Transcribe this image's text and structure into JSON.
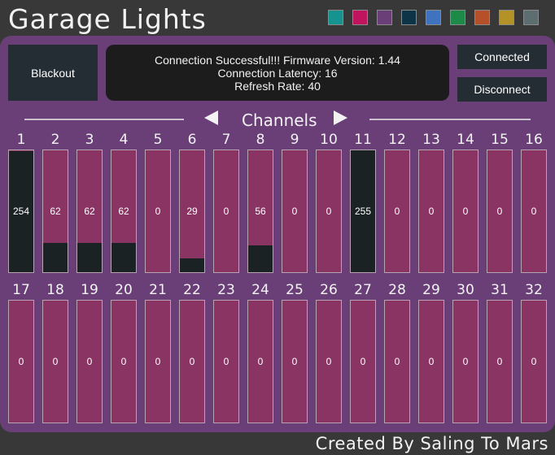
{
  "app": {
    "title": "Garage Lights"
  },
  "swatches": [
    {
      "name": "teal",
      "color": "#16938e"
    },
    {
      "name": "magenta",
      "color": "#c0155e"
    },
    {
      "name": "purple",
      "color": "#6a3f78"
    },
    {
      "name": "dark-navy",
      "color": "#0e3447"
    },
    {
      "name": "blue",
      "color": "#3f73bf"
    },
    {
      "name": "green",
      "color": "#1e8a4a"
    },
    {
      "name": "orange",
      "color": "#b5502b"
    },
    {
      "name": "gold",
      "color": "#b39327"
    },
    {
      "name": "slate",
      "color": "#5e6e70"
    }
  ],
  "controls": {
    "blackout_label": "Blackout",
    "connected_label": "Connected",
    "disconnect_label": "Disconnect"
  },
  "status": {
    "line1": "Connection Successful!!! Firmware Version: 1.44",
    "line2": "Connection Latency: 16",
    "line3": "Refresh Rate: 40"
  },
  "channels_header": {
    "label": "Channels"
  },
  "channels_row1": [
    {
      "num": "1",
      "value": 254
    },
    {
      "num": "2",
      "value": 62
    },
    {
      "num": "3",
      "value": 62
    },
    {
      "num": "4",
      "value": 62
    },
    {
      "num": "5",
      "value": 0
    },
    {
      "num": "6",
      "value": 29
    },
    {
      "num": "7",
      "value": 0
    },
    {
      "num": "8",
      "value": 56
    },
    {
      "num": "9",
      "value": 0
    },
    {
      "num": "10",
      "value": 0
    },
    {
      "num": "11",
      "value": 255
    },
    {
      "num": "12",
      "value": 0
    },
    {
      "num": "13",
      "value": 0
    },
    {
      "num": "14",
      "value": 0
    },
    {
      "num": "15",
      "value": 0
    },
    {
      "num": "16",
      "value": 0
    }
  ],
  "channels_row2": [
    {
      "num": "17",
      "value": 0
    },
    {
      "num": "18",
      "value": 0
    },
    {
      "num": "19",
      "value": 0
    },
    {
      "num": "20",
      "value": 0
    },
    {
      "num": "21",
      "value": 0
    },
    {
      "num": "22",
      "value": 0
    },
    {
      "num": "23",
      "value": 0
    },
    {
      "num": "24",
      "value": 0
    },
    {
      "num": "25",
      "value": 0
    },
    {
      "num": "26",
      "value": 0
    },
    {
      "num": "27",
      "value": 0
    },
    {
      "num": "28",
      "value": 0
    },
    {
      "num": "29",
      "value": 0
    },
    {
      "num": "30",
      "value": 0
    },
    {
      "num": "31",
      "value": 0
    },
    {
      "num": "32",
      "value": 0
    }
  ],
  "fader_max": 255,
  "colors": {
    "panel": "#6a3f78",
    "fader_track": "#8a3463",
    "fader_fill": "#1b2224",
    "button": "#252d34"
  },
  "footer": {
    "credit": "Created By Saling To Mars"
  }
}
